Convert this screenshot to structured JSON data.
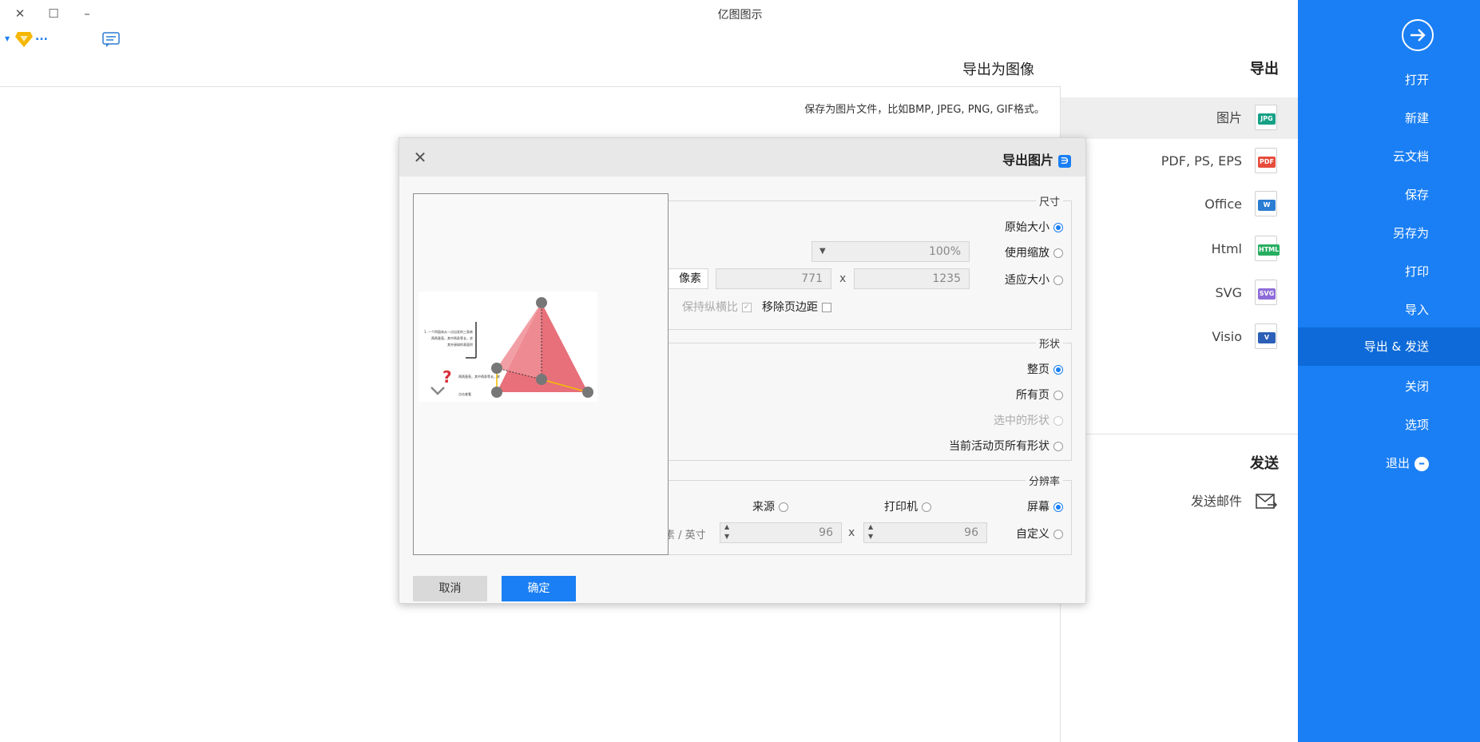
{
  "app": {
    "title": "亿图图示",
    "window_controls": {
      "close": "✕",
      "maximize": "☐",
      "minimize": "–"
    },
    "toolbar_more": "..."
  },
  "sidebar": {
    "items": [
      {
        "label": "打开"
      },
      {
        "label": "新建"
      },
      {
        "label": "云文档"
      },
      {
        "label": "保存"
      },
      {
        "label": "另存为"
      },
      {
        "label": "打印"
      },
      {
        "label": "导入"
      },
      {
        "label": "导出 & 发送",
        "active": true
      },
      {
        "label": "关闭"
      },
      {
        "label": "选项"
      },
      {
        "label": "退出"
      }
    ],
    "accent": "#1a7ff4"
  },
  "export_panel": {
    "title": "导出",
    "formats": [
      {
        "label": "图片",
        "tag": "JPG",
        "tag_color": "#16a085",
        "active": true
      },
      {
        "label": "PDF, PS, EPS",
        "tag": "PDF",
        "tag_color": "#e74c3c"
      },
      {
        "label": "Office",
        "tag": "W",
        "tag_color": "#2b7cd3"
      },
      {
        "label": "Html",
        "tag": "HTML",
        "tag_color": "#27ae60"
      },
      {
        "label": "SVG",
        "tag": "SVG",
        "tag_color": "#8e6cd8"
      },
      {
        "label": "Visio",
        "tag": "V",
        "tag_color": "#2b5fb8"
      }
    ],
    "send_title": "发送",
    "send_items": [
      {
        "label": "发送邮件"
      }
    ]
  },
  "main": {
    "header": "导出为图像",
    "description": "保存为图片文件，比如BMP, JPEG, PNG, GIF格式。"
  },
  "dialog": {
    "title": "导出图片",
    "size_group": {
      "legend": "尺寸",
      "original": "原始大小",
      "use_scale": "使用缩放",
      "scale_value": "100%",
      "fit_size": "适应大小",
      "width": "1235",
      "height": "771",
      "x_sign": "x",
      "unit": "像素",
      "remove_margin": "移除页边距",
      "keep_ratio": "保持纵横比"
    },
    "shape_group": {
      "legend": "形状",
      "whole_page": "整页",
      "all_pages": "所有页",
      "selected_shapes": "选中的形状",
      "current_active_all": "当前活动页所有形状"
    },
    "resolution_group": {
      "legend": "分辨率",
      "screen": "屏幕",
      "printer": "打印机",
      "source": "来源",
      "custom": "自定义",
      "dpi_x": "96",
      "dpi_y": "96",
      "x_sign": "x",
      "unit": "像素 / 英寸"
    },
    "ok": "确定",
    "cancel": "取消",
    "preview_note_1": "1. 一个四面体从一点出发的三条棱",
    "preview_note_2": "两两垂直，其中两条等长，求",
    "preview_note_3": "其外接球的表面积",
    "preview_label_q": "?",
    "preview_caption": "点击查看"
  }
}
